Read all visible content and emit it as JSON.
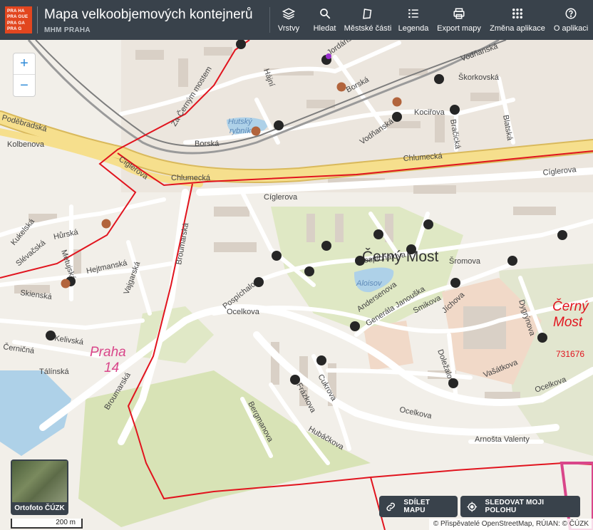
{
  "header": {
    "logo_lines": [
      "PRA HA",
      "PRA GUE",
      "PRA GA",
      "PRA G"
    ],
    "title": "Mapa velkoobjemových kontejnerů",
    "subtitle": "MHM PRAHA"
  },
  "toolbar": {
    "items": [
      {
        "id": "layers",
        "label": "Vrstvy",
        "icon": "layers-icon"
      },
      {
        "id": "search",
        "label": "Hledat",
        "icon": "search-icon"
      },
      {
        "id": "districts",
        "label": "Městské části",
        "icon": "map-outline-icon"
      },
      {
        "id": "legend",
        "label": "Legenda",
        "icon": "list-icon"
      },
      {
        "id": "export",
        "label": "Export mapy",
        "icon": "printer-icon"
      },
      {
        "id": "apps",
        "label": "Změna aplikace",
        "icon": "grid-icon"
      },
      {
        "id": "about",
        "label": "O aplikaci",
        "icon": "help-icon"
      }
    ]
  },
  "zoom": {
    "in": "+",
    "out": "−"
  },
  "basemap_switch": {
    "label": "Ortofoto ČÚZK"
  },
  "scale": {
    "label": "200 m"
  },
  "share_button": {
    "label": "SDÍLET MAPU",
    "icon": "link-icon"
  },
  "locate_button": {
    "label": "SLEDOVAT MOJI POLOHU",
    "icon": "target-icon"
  },
  "attribution": "© Přispěvatelé OpenStreetMap, RÚIAN: © ČÚZK",
  "map_labels": {
    "district_praha14": [
      "Praha",
      "14"
    ],
    "district_cerny_most": [
      "Černý",
      "Most"
    ],
    "neighbourhood": "Černý Most",
    "code": "731676",
    "pond_hutsky": [
      "Hutský",
      "rybník"
    ],
    "pond_aloisov": "Aloisov",
    "streets": {
      "podebradska": "Poděbradská",
      "kolbenova": "Kolbenova",
      "ciglerova": "Cíglerova",
      "ciglerova2": "Cíglerova",
      "ciglerova3": "Cíglerova",
      "chlumecka": "Chlumecká",
      "chlumecka2": "Chlumecká",
      "borska": "Borská",
      "borska2": "Borská",
      "vodnanska": "Vodňanská",
      "vodnanska2": "Vodňanská",
      "skorkovska": "Škorkovská",
      "kocirova": "Kociřova",
      "blatska": "Blatská",
      "bracicka": "Bračická",
      "jordanska": "Jordánská",
      "hajni": "Hájní",
      "za_cernym_mostem": "Za Černým mostem",
      "kukelska": "Kukelská",
      "slevacska": "Slévačská",
      "hurska": "Hůrská",
      "metujska": "Metujská",
      "hejtmanska": "Hejtmanská",
      "vajgarska": "Vajgarská",
      "skienska": "Skienská",
      "bromarska": "Broumarská",
      "broumarska2": "Broumarská",
      "kelivska": "Kelivská",
      "cernicna": "Černičná",
      "talinska": "Tálínská",
      "pospichalova": "Pospíchalova",
      "pospichalova2": "Pospíchalova",
      "ocelkova": "Ocelkova",
      "ocelkova2": "Ocelkova",
      "ocelkova3": "Ocelkova",
      "sromova": "Šromova",
      "andersenova": "Andersenova",
      "gen_janouska": "Generála Janouška",
      "smikova": "Smikova",
      "jichova": "Jíchova",
      "dygrynova": "Dygrýnova",
      "dolezalova": "Doležalova",
      "vasatkova": "Vašátkova",
      "cukrova": "Cukrova",
      "frazkova": "Frázkova",
      "bergmanova": "Bergmanova",
      "hubackova": "Hubáčkova",
      "arnosta_valenty": "Arnošta Valenty"
    }
  },
  "colors": {
    "header_bg": "#39424b",
    "container_dot": "#262626",
    "container_dot_brown": "#b2643c",
    "district_border": "#e1141e",
    "highway": "#f6df8d",
    "water": "#aed1e8",
    "park": "#d6e3b5"
  }
}
